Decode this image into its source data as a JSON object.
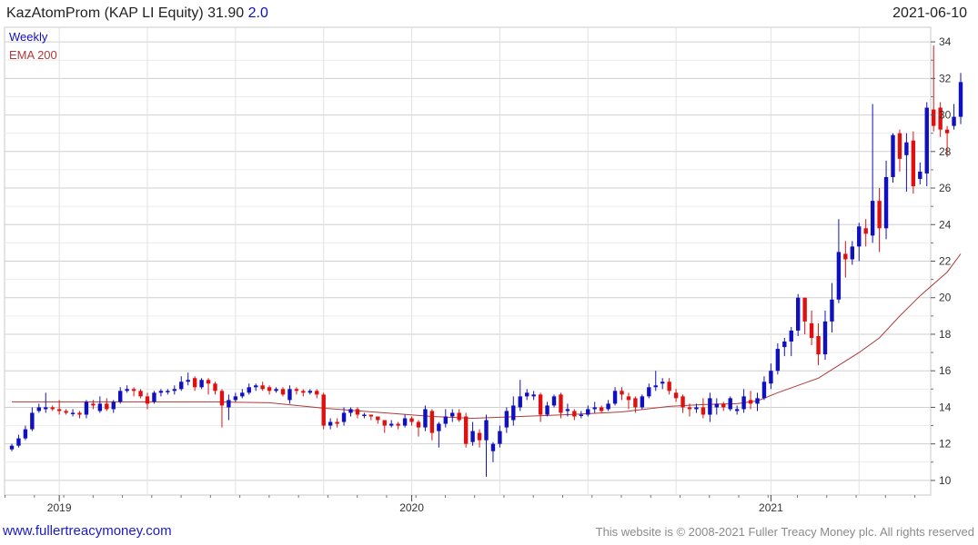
{
  "header": {
    "title": "KazAtomProm (KAP LI Equity) 31.90",
    "change": "2.0",
    "date": "2021-06-10"
  },
  "footer": {
    "site": "www.fullertreacymoney.com",
    "copyright": "This website is © 2008-2021 Fuller Treacy Money plc. All rights reserved"
  },
  "colors": {
    "up": "#1010c0",
    "down": "#e01010",
    "ema": "#b03a3a",
    "grid": "#d9d9d9"
  },
  "chart_data": {
    "type": "candlestick",
    "legend": [
      "Weekly",
      "EMA 200"
    ],
    "legend_colors": [
      "#1010c0",
      "#b03a3a"
    ],
    "ylim": [
      9.2,
      34.8
    ],
    "yticks": [
      10,
      12,
      14,
      16,
      18,
      20,
      22,
      24,
      26,
      28,
      30,
      32,
      34
    ],
    "xticks": [
      {
        "label": "2019",
        "index": 7
      },
      {
        "label": "2020",
        "index": 59
      },
      {
        "label": "2021",
        "index": 112
      }
    ],
    "grid": true,
    "candles": [
      [
        11.7,
        11.9,
        11.6,
        12.0
      ],
      [
        11.9,
        12.3,
        11.8,
        12.5
      ],
      [
        12.3,
        12.8,
        12.2,
        13.0
      ],
      [
        12.8,
        13.7,
        12.7,
        14.0
      ],
      [
        13.8,
        14.0,
        13.7,
        14.2
      ],
      [
        13.9,
        14.0,
        13.7,
        14.8
      ],
      [
        14.0,
        13.9,
        13.8,
        14.1
      ],
      [
        13.9,
        13.8,
        13.6,
        14.4
      ],
      [
        13.8,
        13.7,
        13.6,
        13.9
      ],
      [
        13.7,
        13.7,
        13.5,
        13.9
      ],
      [
        13.7,
        13.6,
        13.4,
        13.8
      ],
      [
        13.6,
        14.3,
        13.4,
        14.4
      ],
      [
        14.2,
        14.1,
        13.9,
        14.4
      ],
      [
        13.8,
        14.2,
        13.7,
        14.6
      ],
      [
        14.2,
        13.9,
        13.8,
        14.5
      ],
      [
        13.9,
        14.3,
        13.7,
        14.4
      ],
      [
        14.3,
        14.9,
        14.2,
        15.1
      ],
      [
        14.9,
        15.0,
        14.8,
        15.2
      ],
      [
        15.0,
        14.9,
        14.6,
        15.1
      ],
      [
        14.9,
        14.6,
        14.5,
        15.0
      ],
      [
        14.6,
        14.2,
        13.9,
        14.8
      ],
      [
        14.3,
        14.8,
        14.2,
        14.9
      ],
      [
        14.8,
        14.9,
        14.6,
        15.0
      ],
      [
        14.9,
        14.9,
        14.7,
        15.0
      ],
      [
        14.9,
        15.0,
        14.7,
        15.2
      ],
      [
        15.0,
        15.4,
        14.9,
        15.7
      ],
      [
        15.4,
        15.5,
        15.2,
        15.9
      ],
      [
        15.6,
        15.1,
        14.9,
        15.7
      ],
      [
        15.1,
        15.5,
        15.0,
        15.6
      ],
      [
        15.5,
        15.3,
        14.7,
        15.6
      ],
      [
        15.3,
        14.9,
        14.7,
        15.4
      ],
      [
        14.9,
        14.1,
        12.9,
        15.0
      ],
      [
        14.0,
        14.4,
        13.3,
        14.7
      ],
      [
        14.4,
        14.6,
        14.3,
        14.8
      ],
      [
        14.6,
        14.8,
        14.5,
        15.0
      ],
      [
        14.8,
        15.1,
        14.7,
        15.3
      ],
      [
        15.1,
        15.2,
        14.9,
        15.3
      ],
      [
        15.2,
        15.0,
        14.9,
        15.4
      ],
      [
        15.1,
        14.9,
        14.7,
        15.2
      ],
      [
        14.9,
        15.0,
        14.8,
        15.1
      ],
      [
        15.0,
        14.7,
        14.6,
        15.1
      ],
      [
        14.4,
        15.0,
        14.2,
        15.2
      ],
      [
        15.0,
        14.9,
        14.7,
        15.1
      ],
      [
        14.9,
        14.8,
        14.6,
        15.0
      ],
      [
        14.8,
        14.9,
        14.7,
        15.0
      ],
      [
        14.9,
        14.7,
        14.5,
        15.0
      ],
      [
        14.7,
        13.0,
        12.8,
        14.8
      ],
      [
        13.0,
        13.2,
        12.8,
        13.4
      ],
      [
        13.2,
        13.1,
        12.9,
        13.4
      ],
      [
        13.2,
        13.7,
        13.0,
        14.0
      ],
      [
        13.7,
        13.9,
        13.5,
        14.0
      ],
      [
        13.9,
        13.6,
        13.4,
        14.0
      ],
      [
        13.6,
        13.6,
        13.4,
        13.7
      ],
      [
        13.6,
        13.5,
        13.3,
        13.6
      ],
      [
        13.5,
        13.3,
        13.1,
        13.5
      ],
      [
        13.3,
        13.0,
        12.6,
        13.3
      ],
      [
        13.0,
        13.1,
        12.9,
        13.3
      ],
      [
        13.1,
        13.0,
        12.8,
        13.2
      ],
      [
        13.0,
        13.4,
        12.9,
        13.6
      ],
      [
        13.4,
        13.2,
        13.0,
        13.5
      ],
      [
        13.2,
        12.9,
        12.4,
        13.3
      ],
      [
        12.9,
        13.9,
        12.7,
        14.1
      ],
      [
        13.8,
        12.6,
        12.2,
        13.9
      ],
      [
        12.7,
        13.1,
        11.8,
        13.2
      ],
      [
        13.1,
        13.5,
        12.9,
        13.9
      ],
      [
        13.5,
        13.7,
        13.2,
        13.9
      ],
      [
        13.7,
        13.3,
        13.2,
        13.9
      ],
      [
        13.5,
        12.0,
        11.8,
        13.7
      ],
      [
        12.1,
        12.7,
        11.9,
        13.2
      ],
      [
        12.6,
        12.2,
        11.8,
        12.8
      ],
      [
        12.2,
        13.3,
        10.2,
        13.6
      ],
      [
        11.6,
        12.0,
        11.0,
        12.1
      ],
      [
        12.0,
        12.7,
        11.8,
        13.0
      ],
      [
        12.9,
        13.8,
        12.6,
        14.0
      ],
      [
        13.3,
        14.1,
        13.0,
        14.6
      ],
      [
        14.0,
        14.6,
        13.8,
        15.5
      ],
      [
        14.6,
        14.8,
        14.4,
        15.0
      ],
      [
        14.6,
        14.7,
        14.4,
        14.9
      ],
      [
        14.7,
        13.6,
        13.2,
        14.8
      ],
      [
        13.6,
        14.1,
        13.5,
        14.3
      ],
      [
        14.1,
        14.6,
        14.0,
        14.7
      ],
      [
        14.7,
        13.7,
        13.4,
        14.8
      ],
      [
        13.8,
        13.9,
        13.5,
        14.2
      ],
      [
        13.8,
        13.5,
        13.3,
        13.9
      ],
      [
        13.6,
        13.6,
        13.4,
        13.8
      ],
      [
        13.6,
        13.9,
        13.5,
        14.1
      ],
      [
        13.9,
        14.0,
        13.7,
        14.3
      ],
      [
        14.0,
        13.8,
        13.7,
        14.1
      ],
      [
        13.9,
        14.2,
        13.8,
        14.4
      ],
      [
        14.2,
        14.9,
        14.1,
        15.1
      ],
      [
        14.9,
        14.7,
        14.4,
        15.1
      ],
      [
        14.6,
        14.4,
        13.9,
        14.8
      ],
      [
        14.5,
        14.0,
        13.7,
        14.6
      ],
      [
        14.0,
        14.6,
        13.9,
        14.7
      ],
      [
        14.6,
        15.1,
        14.5,
        15.3
      ],
      [
        15.1,
        15.2,
        14.9,
        16.0
      ],
      [
        15.3,
        15.4,
        15.0,
        15.6
      ],
      [
        15.4,
        14.9,
        14.7,
        15.6
      ],
      [
        14.8,
        14.5,
        14.3,
        15.0
      ],
      [
        14.6,
        14.0,
        13.7,
        14.7
      ],
      [
        14.0,
        13.9,
        13.5,
        14.2
      ],
      [
        13.9,
        14.0,
        13.7,
        14.2
      ],
      [
        14.0,
        13.6,
        13.4,
        14.5
      ],
      [
        13.6,
        14.5,
        13.2,
        14.8
      ],
      [
        14.0,
        14.2,
        13.6,
        14.5
      ],
      [
        14.2,
        14.0,
        13.8,
        14.3
      ],
      [
        13.9,
        14.5,
        13.8,
        14.6
      ],
      [
        13.8,
        13.9,
        13.6,
        14.1
      ],
      [
        13.9,
        14.6,
        13.7,
        15.0
      ],
      [
        14.4,
        14.2,
        13.9,
        14.9
      ],
      [
        14.2,
        14.5,
        13.8,
        14.8
      ],
      [
        14.5,
        15.4,
        14.4,
        15.7
      ],
      [
        15.3,
        16.0,
        15.0,
        16.4
      ],
      [
        16.0,
        17.2,
        15.8,
        17.5
      ],
      [
        17.3,
        17.6,
        16.8,
        17.8
      ],
      [
        17.6,
        18.2,
        16.8,
        18.4
      ],
      [
        18.2,
        20.0,
        17.9,
        20.2
      ],
      [
        20.0,
        18.7,
        18.0,
        20.0
      ],
      [
        18.6,
        17.8,
        17.4,
        19.3
      ],
      [
        17.9,
        16.9,
        16.3,
        18.6
      ],
      [
        16.9,
        18.7,
        16.6,
        19.3
      ],
      [
        18.7,
        19.9,
        18.1,
        20.8
      ],
      [
        19.9,
        22.5,
        19.7,
        24.3
      ],
      [
        22.4,
        22.1,
        21.1,
        23.1
      ],
      [
        22.1,
        22.8,
        21.8,
        23.1
      ],
      [
        22.8,
        23.9,
        22.0,
        24.1
      ],
      [
        23.8,
        23.5,
        22.8,
        24.3
      ],
      [
        23.4,
        25.3,
        23.0,
        30.6
      ],
      [
        25.3,
        23.8,
        22.5,
        26.0
      ],
      [
        23.8,
        26.6,
        23.2,
        27.5
      ],
      [
        26.6,
        28.9,
        26.3,
        29.0
      ],
      [
        29.0,
        27.6,
        26.9,
        29.2
      ],
      [
        27.8,
        28.5,
        25.8,
        29.0
      ],
      [
        28.6,
        26.1,
        25.7,
        29.1
      ],
      [
        26.5,
        26.9,
        26.2,
        27.4
      ],
      [
        26.8,
        30.4,
        26.1,
        30.7
      ],
      [
        30.3,
        29.4,
        29.1,
        33.8
      ],
      [
        30.4,
        29.2,
        28.8,
        30.7
      ],
      [
        29.2,
        29.0,
        27.7,
        29.4
      ],
      [
        29.4,
        29.9,
        29.2,
        30.6
      ],
      [
        29.9,
        31.8,
        29.5,
        32.3
      ]
    ],
    "ema": [
      [
        0,
        14.3
      ],
      [
        22,
        14.3
      ],
      [
        30,
        14.3
      ],
      [
        38,
        14.25
      ],
      [
        46,
        13.95
      ],
      [
        55,
        13.7
      ],
      [
        62,
        13.5
      ],
      [
        68,
        13.4
      ],
      [
        75,
        13.5
      ],
      [
        82,
        13.6
      ],
      [
        90,
        13.75
      ],
      [
        97,
        14.05
      ],
      [
        102,
        14.15
      ],
      [
        107,
        14.2
      ],
      [
        110,
        14.35
      ],
      [
        113,
        14.8
      ],
      [
        116,
        15.2
      ],
      [
        119,
        15.6
      ],
      [
        122,
        16.3
      ],
      [
        125,
        17.0
      ],
      [
        128,
        17.8
      ],
      [
        131,
        19.0
      ],
      [
        134,
        20.1
      ],
      [
        138,
        21.4
      ],
      [
        140,
        22.4
      ]
    ]
  }
}
